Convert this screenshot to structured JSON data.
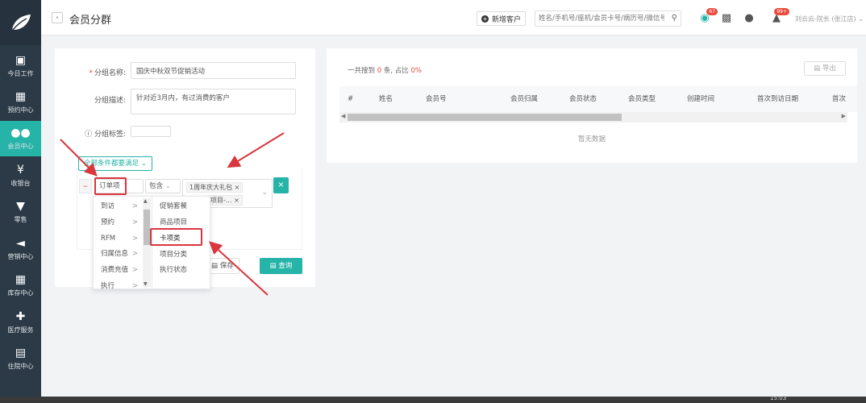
{
  "sidebar": {
    "items": [
      {
        "label": "今日工作",
        "icon": "monitor-icon"
      },
      {
        "label": "预约中心",
        "icon": "calendar-icon"
      },
      {
        "label": "会员中心",
        "icon": "users-icon",
        "active": true
      },
      {
        "label": "收银台",
        "icon": "yen-icon"
      },
      {
        "label": "零售",
        "icon": "cart-icon"
      },
      {
        "label": "营销中心",
        "icon": "megaphone-icon"
      },
      {
        "label": "库存中心",
        "icon": "grid-icon"
      },
      {
        "label": "医疗服务",
        "icon": "medkit-icon"
      },
      {
        "label": "住院中心",
        "icon": "clipboard-icon"
      }
    ]
  },
  "header": {
    "title": "会员分群",
    "new_customer": "新增客户",
    "search_placeholder": "姓名/手机号/座机/会员卡号/病历号/微信号",
    "badges": {
      "wechat": "67",
      "notify": "99+"
    },
    "user": "刘云云-院长 (张江店)"
  },
  "form": {
    "name_label": "分组名称:",
    "name_value": "国庆中秋双节促销活动",
    "desc_label": "分组描述:",
    "desc_value": "针对近3月内，有过消费的客户",
    "tag_label": "分组标签:",
    "condition_toggle": "全部条件都要满足",
    "condition": {
      "field": "订单项",
      "operator": "包含",
      "tags": [
        "1周年庆大礼包",
        "项目-..."
      ]
    },
    "save_label": "保存",
    "query_label": "查询"
  },
  "cascader": {
    "level1": [
      {
        "label": "到访",
        "arrow": ">"
      },
      {
        "label": "预约",
        "arrow": ">"
      },
      {
        "label": "RFM",
        "arrow": ">"
      },
      {
        "label": "归属信息",
        "arrow": ">"
      },
      {
        "label": "消费充值",
        "arrow": ">"
      },
      {
        "label": "执行",
        "arrow": ">"
      }
    ],
    "level2": [
      "促销套餐",
      "商品项目",
      "卡项类",
      "项目分类",
      "执行状态"
    ],
    "highlighted": "卡项类"
  },
  "results": {
    "prefix": "一共搜到",
    "count": "0",
    "unit": "条, 占比",
    "ratio": "0%",
    "export_label": "导出",
    "columns": [
      "#",
      "姓名",
      "会员号",
      "会员归属",
      "会员状态",
      "会员类型",
      "创建时间",
      "首次到访日期",
      "首次"
    ],
    "empty_text": "暂无数据"
  },
  "taskbar": {
    "clock": "15:03"
  },
  "colors": {
    "accent": "#26b3a8",
    "sidebar": "#2c3a47",
    "danger": "#e84c3d",
    "annotation": "#d9363e"
  }
}
